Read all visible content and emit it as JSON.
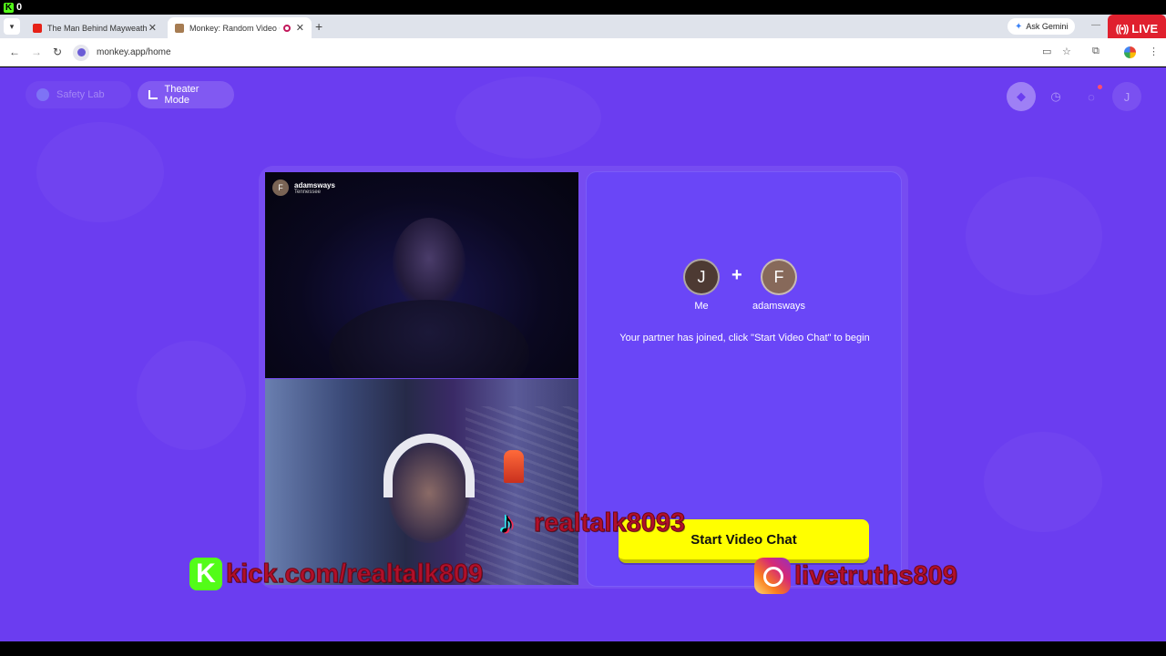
{
  "stream": {
    "viewer_count": "0",
    "live_label": "LIVE"
  },
  "browser": {
    "tabs": [
      {
        "title": "The Man Behind Mayweather -"
      },
      {
        "title": "Monkey: Random Video Ch"
      }
    ],
    "close_glyph": "✕",
    "new_tab_glyph": "+",
    "ask_gemini": "Ask Gemini",
    "url": "monkey.app/home"
  },
  "header": {
    "safety_lab": "Safety Lab",
    "theater_mode": "Theater Mode",
    "profile_initial": "J"
  },
  "videos": {
    "partner_name": "adamsways",
    "partner_location": "Tennessee",
    "partner_initial": "F"
  },
  "match": {
    "me_initial": "J",
    "me_label": "Me",
    "partner_initial": "F",
    "partner_label": "adamsways",
    "plus": "+",
    "message": "Your partner has joined, click \"Start Video Chat\" to begin",
    "start_button": "Start Video Chat"
  },
  "overlays": {
    "tiktok": "realtalk8093",
    "kick": "kick.com/realtalk809",
    "instagram": "livetruths809"
  },
  "colors": {
    "page_bg": "#6b3df0",
    "panel_bg": "#6a46f7",
    "start_button": "#ffff00",
    "live_red": "#e0202e",
    "kick_green": "#53fc18"
  }
}
